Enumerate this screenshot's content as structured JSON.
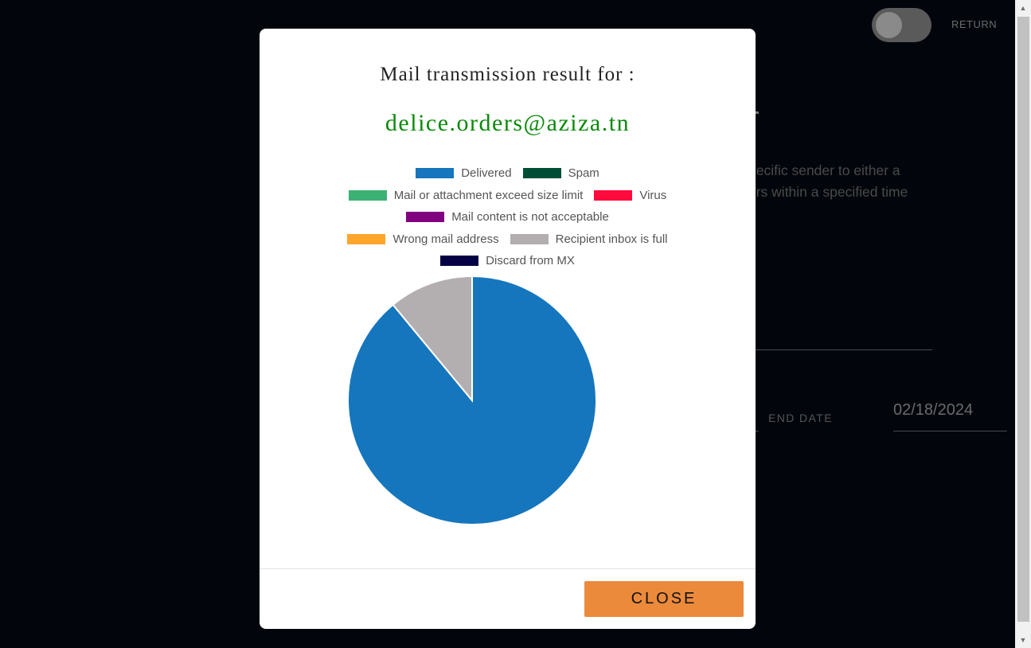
{
  "header": {
    "return_label": "RETURN"
  },
  "background": {
    "description": "pecific sender to either a\ners within a specified time",
    "end_date_label": "END DATE",
    "end_date_value": "02/18/2024"
  },
  "modal": {
    "title": "Mail transmission result for :",
    "email": "delice.orders@aziza.tn",
    "close_label": "CLOSE"
  },
  "colors": {
    "email": "#0a8a0a",
    "close_button": "#ec8a3c"
  },
  "chart_data": {
    "type": "pie",
    "legend_position": "top",
    "series": [
      {
        "name": "Delivered",
        "value": 89,
        "color": "#1576bd"
      },
      {
        "name": "Spam",
        "value": 0,
        "color": "#004d36"
      },
      {
        "name": "Mail or attachment exceed size limit",
        "value": 0,
        "color": "#3bb273"
      },
      {
        "name": "Virus",
        "value": 0,
        "color": "#ff0a3c"
      },
      {
        "name": "Mail content is not acceptable",
        "value": 0,
        "color": "#800080"
      },
      {
        "name": "Wrong mail address",
        "value": 0,
        "color": "#ffa52c"
      },
      {
        "name": "Recipient inbox is full",
        "value": 11,
        "color": "#b3aeb0"
      },
      {
        "name": "Discard from MX",
        "value": 0,
        "color": "#050044"
      }
    ],
    "legend_rows": [
      [
        0,
        1
      ],
      [
        2,
        3
      ],
      [
        4
      ],
      [
        5,
        6
      ],
      [
        7
      ]
    ]
  }
}
